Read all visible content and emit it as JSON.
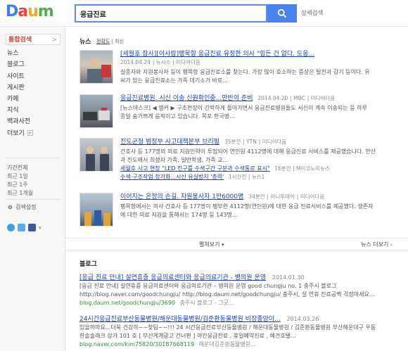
{
  "header": {
    "logo": {
      "d": "D",
      "a": "a",
      "u": "u",
      "m": "m"
    },
    "search_value": "응급진료",
    "advanced_search": "상세검색"
  },
  "sidebar": {
    "items": [
      {
        "label": "통합검색",
        "active": true,
        "arrow": ">"
      },
      {
        "label": "뉴스"
      },
      {
        "label": "블로그"
      },
      {
        "label": "사이트"
      },
      {
        "label": "게시판"
      },
      {
        "label": "카페"
      },
      {
        "label": "지식"
      },
      {
        "label": "백과사전"
      },
      {
        "label": "더보기"
      }
    ],
    "period_title": "기간전체",
    "periods": [
      "최근 1일",
      "최근 1주",
      "최근 1개월"
    ],
    "settings": "검색설정"
  },
  "news": {
    "title": "뉴스",
    "sort_accuracy": "정확도",
    "sort_latest": "최신",
    "items": [
      {
        "title": "[세월호 참사][이사람]팽목항 응급진료 유정한 의사 \"힘든 건 없다. 도움...",
        "date": "2014.04.24",
        "source": "뉴시스",
        "media": "미디어다음",
        "snippet1": "실종자와 자원봉사자 등이 팽목항 응급진료소를 찾는다. 가장 많이 호소하는 증상은 탈진과 감기 등이다. 유",
        "snippet2": "씨가 있는 응급진료소는 가족 대기소가 바로..."
      },
      {
        "title": "응급진료병원. 시신 이송 신원확인중...만반의 준비",
        "date": "2014.04.20",
        "source": "MBC",
        "media": "미디어다음",
        "snippet1": "[뉴스데스크] ◀ 앵커 ▶ 구조현장이 긴박하게 돌아가면서 응급진료병원들도 시신이 계속 이송되는 등 하루",
        "snippet2": "종일 숨가쁘게 움직이고 있습니다. 목포 한국병..."
      },
      {
        "title": "진도군청 범정부 사고대책본부 브리핑",
        "date": "35분전",
        "source": "YTN",
        "media": "미디어다음",
        "snippet1": "간호사 등 177명의 의료 지원인력이 투입되어 연인원 4112명에 대해 응급진료 서비스를 제공했습니다. 안산",
        "snippet2": "과 진도에서 희생자 가족, 일반학생, 가족 교...",
        "sub1_title": "세월호 사고 현장 \"LED 전구를 수색구간 구분과 수색통로 표시\"",
        "sub1_date": "16분전",
        "sub1_source": "M이코노미뉴스",
        "sub2_title": "수색·구조작업 장기화...시신 유실방지 '총력'",
        "sub2_date": "1시간전",
        "sub2_source": "뉴스1"
      },
      {
        "title": "이어지는 온정의 손길. 자원봉사자 1만6000명",
        "date": "34분전",
        "source": "머니투데이",
        "media": "미디어다음",
        "snippet1": "팽목항에서는 의사 간호사 등 177명이 팽부한 4112명(연인원)에 대한 응급 진료서비스를 제공했다. 생존자",
        "snippet2": "에 대한 의료 지원을 통해서는 174명 등 143명..."
      }
    ],
    "more_center": "펼쳐보기",
    "more_right": "뉴스 더보기"
  },
  "blog": {
    "title": "블로그",
    "items": [
      {
        "title": "[응급 진료 안내] 설연휴중 응급의료센터와 응급의료기관 - 병의원 운영",
        "date": "2014.01.30",
        "snippet1": "[응급 진료 안내] 설연휴중 응급의료센터와 응급의료기관 – 병의원 운영 good chungju no. 1 충주시 블로그",
        "snippet2": "http://blog.naver.com/goodchungju/ http://blog.daum.net/goodchungju/ 충주시, 설 연휴 진료공백 걱정마세요...",
        "url": "blog.daum.net/goodchungju/3690",
        "source": "충주시 블로그 - 그곳..."
      },
      {
        "title": "24시간응급진료부산동물병원/해운대동물병원/김준환동물병원 비장종양이...",
        "date": "2014.03.26",
        "snippet1": "있을까마요...더욱 건강하~~찾팀~~!!! 24 시간응급진료부산동물병원 / 해운대동물병원 / 김준환동물병원 부산해운대구 우동",
        "snippet2": "한솔솔래크 상가 101 호 [ 부산게계광고 건너편 ] 야간응급진료 , 휴일예약진료 , 예견호텔...",
        "url": "blog.naver.com/kim75820/30187668119",
        "source": "해운대김준환동물병원..."
      }
    ]
  }
}
